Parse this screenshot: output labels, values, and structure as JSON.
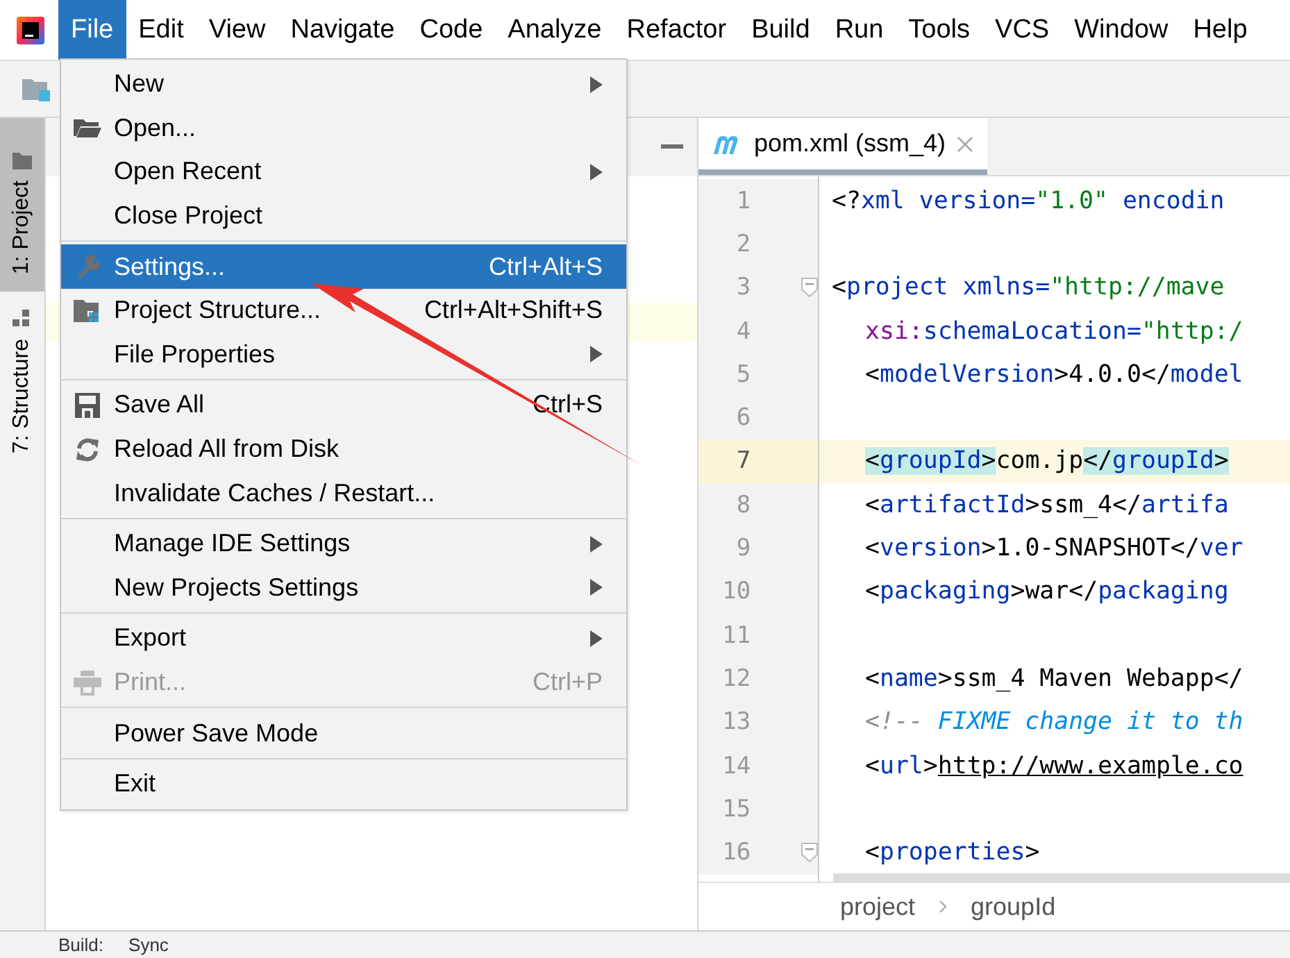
{
  "menubar": {
    "items": [
      {
        "label": "File",
        "selected": true
      },
      {
        "label": "Edit",
        "selected": false
      },
      {
        "label": "View",
        "selected": false
      },
      {
        "label": "Navigate",
        "selected": false
      },
      {
        "label": "Code",
        "selected": false
      },
      {
        "label": "Analyze",
        "selected": false
      },
      {
        "label": "Refactor",
        "selected": false
      },
      {
        "label": "Build",
        "selected": false
      },
      {
        "label": "Run",
        "selected": false
      },
      {
        "label": "Tools",
        "selected": false
      },
      {
        "label": "VCS",
        "selected": false
      },
      {
        "label": "Window",
        "selected": false
      },
      {
        "label": "Help",
        "selected": false
      }
    ]
  },
  "file_menu": {
    "items": [
      {
        "kind": "item",
        "label": "New",
        "submenu": true,
        "selected": false,
        "disabled": false
      },
      {
        "kind": "item",
        "label": "Open...",
        "submenu": false,
        "selected": false,
        "disabled": false
      },
      {
        "kind": "item",
        "label": "Open Recent",
        "submenu": true,
        "selected": false,
        "disabled": false
      },
      {
        "kind": "item",
        "label": "Close Project",
        "submenu": false,
        "selected": false,
        "disabled": false
      },
      {
        "kind": "separator"
      },
      {
        "kind": "item",
        "label": "Settings...",
        "shortcut": "Ctrl+Alt+S",
        "submenu": false,
        "selected": true,
        "disabled": false
      },
      {
        "kind": "item",
        "label": "Project Structure...",
        "shortcut": "Ctrl+Alt+Shift+S",
        "submenu": false,
        "selected": false,
        "disabled": false
      },
      {
        "kind": "item",
        "label": "File Properties",
        "submenu": true,
        "selected": false,
        "disabled": false
      },
      {
        "kind": "separator"
      },
      {
        "kind": "item",
        "label": "Save All",
        "shortcut": "Ctrl+S",
        "submenu": false,
        "selected": false,
        "disabled": false
      },
      {
        "kind": "item",
        "label": "Reload All from Disk",
        "submenu": false,
        "selected": false,
        "disabled": false
      },
      {
        "kind": "item",
        "label": "Invalidate Caches / Restart...",
        "submenu": false,
        "selected": false,
        "disabled": false
      },
      {
        "kind": "separator"
      },
      {
        "kind": "item",
        "label": "Manage IDE Settings",
        "submenu": true,
        "selected": false,
        "disabled": false
      },
      {
        "kind": "item",
        "label": "New Projects Settings",
        "submenu": true,
        "selected": false,
        "disabled": false
      },
      {
        "kind": "separator"
      },
      {
        "kind": "item",
        "label": "Export",
        "submenu": true,
        "selected": false,
        "disabled": false
      },
      {
        "kind": "item",
        "label": "Print...",
        "shortcut": "Ctrl+P",
        "submenu": false,
        "selected": false,
        "disabled": true
      },
      {
        "kind": "separator"
      },
      {
        "kind": "item",
        "label": "Power Save Mode",
        "submenu": false,
        "selected": false,
        "disabled": false
      },
      {
        "kind": "separator"
      },
      {
        "kind": "item",
        "label": "Exit",
        "submenu": false,
        "selected": false,
        "disabled": false
      }
    ]
  },
  "tool_windows": [
    {
      "label": "1: Project",
      "selected": true
    },
    {
      "label": "7: Structure",
      "selected": false
    }
  ],
  "editor": {
    "tabs": [
      {
        "label": "pom.xml (ssm_4)",
        "selected": true
      }
    ],
    "lines": [
      {
        "number": "1",
        "current": false,
        "fold": false,
        "tokens": [
          {
            "kind": "punct",
            "text": "<?"
          },
          {
            "kind": "tag",
            "text": "xml"
          },
          {
            "kind": "attr",
            "text": " version="
          },
          {
            "kind": "value",
            "text": "\"1.0\""
          },
          {
            "kind": "attr",
            "text": " encodin"
          }
        ]
      },
      {
        "number": "2",
        "current": false,
        "fold": false
      },
      {
        "number": "3",
        "current": false,
        "fold": true,
        "tokens": [
          {
            "kind": "punct",
            "text": "<"
          },
          {
            "kind": "tag",
            "text": "project"
          },
          {
            "kind": "attr",
            "text": " xmlns="
          },
          {
            "kind": "value",
            "text": "\"http://mave"
          }
        ],
        "children": [
          {
            "number": "4",
            "current": false,
            "fold": false,
            "tokens": [
              {
                "kind": "ns",
                "text": "xsi:"
              },
              {
                "kind": "attr",
                "text": "schemaLocation="
              },
              {
                "kind": "value",
                "text": "\"http:/"
              }
            ]
          },
          {
            "number": "5",
            "current": false,
            "fold": false,
            "tokens": [
              {
                "kind": "punct",
                "text": "<"
              },
              {
                "kind": "tag",
                "text": "modelVersion"
              },
              {
                "kind": "punct",
                "text": ">"
              },
              {
                "kind": "text",
                "text": "4.0.0"
              },
              {
                "kind": "punct",
                "text": "</"
              },
              {
                "kind": "tag",
                "text": "model"
              }
            ]
          },
          {
            "number": "6",
            "current": false,
            "fold": false
          },
          {
            "number": "7",
            "current": true,
            "fold": false,
            "tokens": [
              {
                "kind": "match",
                "tokens": [
                  {
                    "kind": "punct",
                    "text": "<"
                  },
                  {
                    "kind": "tag",
                    "text": "groupId"
                  },
                  {
                    "kind": "punct",
                    "text": ">"
                  }
                ]
              },
              {
                "kind": "text",
                "text": "com.jp"
              },
              {
                "kind": "match",
                "tokens": [
                  {
                    "kind": "punct",
                    "text": "</"
                  },
                  {
                    "kind": "tag",
                    "text": "groupId"
                  },
                  {
                    "kind": "punct",
                    "text": ">"
                  }
                ]
              }
            ]
          },
          {
            "number": "8",
            "current": false,
            "fold": false,
            "tokens": [
              {
                "kind": "punct",
                "text": "<"
              },
              {
                "kind": "tag",
                "text": "artifactId"
              },
              {
                "kind": "punct",
                "text": ">"
              },
              {
                "kind": "text",
                "text": "ssm_4"
              },
              {
                "kind": "punct",
                "text": "</"
              },
              {
                "kind": "tag",
                "text": "artifa"
              }
            ]
          },
          {
            "number": "9",
            "current": false,
            "fold": false,
            "tokens": [
              {
                "kind": "punct",
                "text": "<"
              },
              {
                "kind": "tag",
                "text": "version"
              },
              {
                "kind": "punct",
                "text": ">"
              },
              {
                "kind": "text",
                "text": "1.0-SNAPSHOT"
              },
              {
                "kind": "punct",
                "text": "</"
              },
              {
                "kind": "tag",
                "text": "ver"
              }
            ]
          },
          {
            "number": "10",
            "current": false,
            "fold": false,
            "tokens": [
              {
                "kind": "punct",
                "text": "<"
              },
              {
                "kind": "tag",
                "text": "packaging"
              },
              {
                "kind": "punct",
                "text": ">"
              },
              {
                "kind": "text",
                "text": "war"
              },
              {
                "kind": "punct",
                "text": "</"
              },
              {
                "kind": "tag",
                "text": "packaging"
              }
            ]
          },
          {
            "number": "11",
            "current": false,
            "fold": false
          },
          {
            "number": "12",
            "current": false,
            "fold": false,
            "tokens": [
              {
                "kind": "punct",
                "text": "<"
              },
              {
                "kind": "tag",
                "text": "name"
              },
              {
                "kind": "punct",
                "text": ">"
              },
              {
                "kind": "text",
                "text": "ssm_4 Maven Webapp</"
              }
            ]
          },
          {
            "number": "13",
            "current": false,
            "fold": false,
            "tokens": [
              {
                "kind": "comment",
                "text": "<!-- "
              },
              {
                "kind": "todo",
                "text": "FIXME change it to th"
              }
            ]
          },
          {
            "number": "14",
            "current": false,
            "fold": false,
            "tokens": [
              {
                "kind": "punct",
                "text": "<"
              },
              {
                "kind": "tag",
                "text": "url"
              },
              {
                "kind": "punct",
                "text": ">"
              },
              {
                "kind": "link",
                "text": "http://www.example.co"
              }
            ]
          },
          {
            "number": "15",
            "current": false,
            "fold": false
          },
          {
            "number": "16",
            "current": false,
            "fold": true,
            "tokens": [
              {
                "kind": "punct",
                "text": "<"
              },
              {
                "kind": "tag",
                "text": "properties"
              },
              {
                "kind": "punct",
                "text": ">"
              }
            ]
          }
        ]
      }
    ],
    "breadcrumb": [
      "project",
      "groupId"
    ]
  },
  "bottom_bar": {
    "tabs": [
      "Build:",
      "Sync"
    ]
  }
}
